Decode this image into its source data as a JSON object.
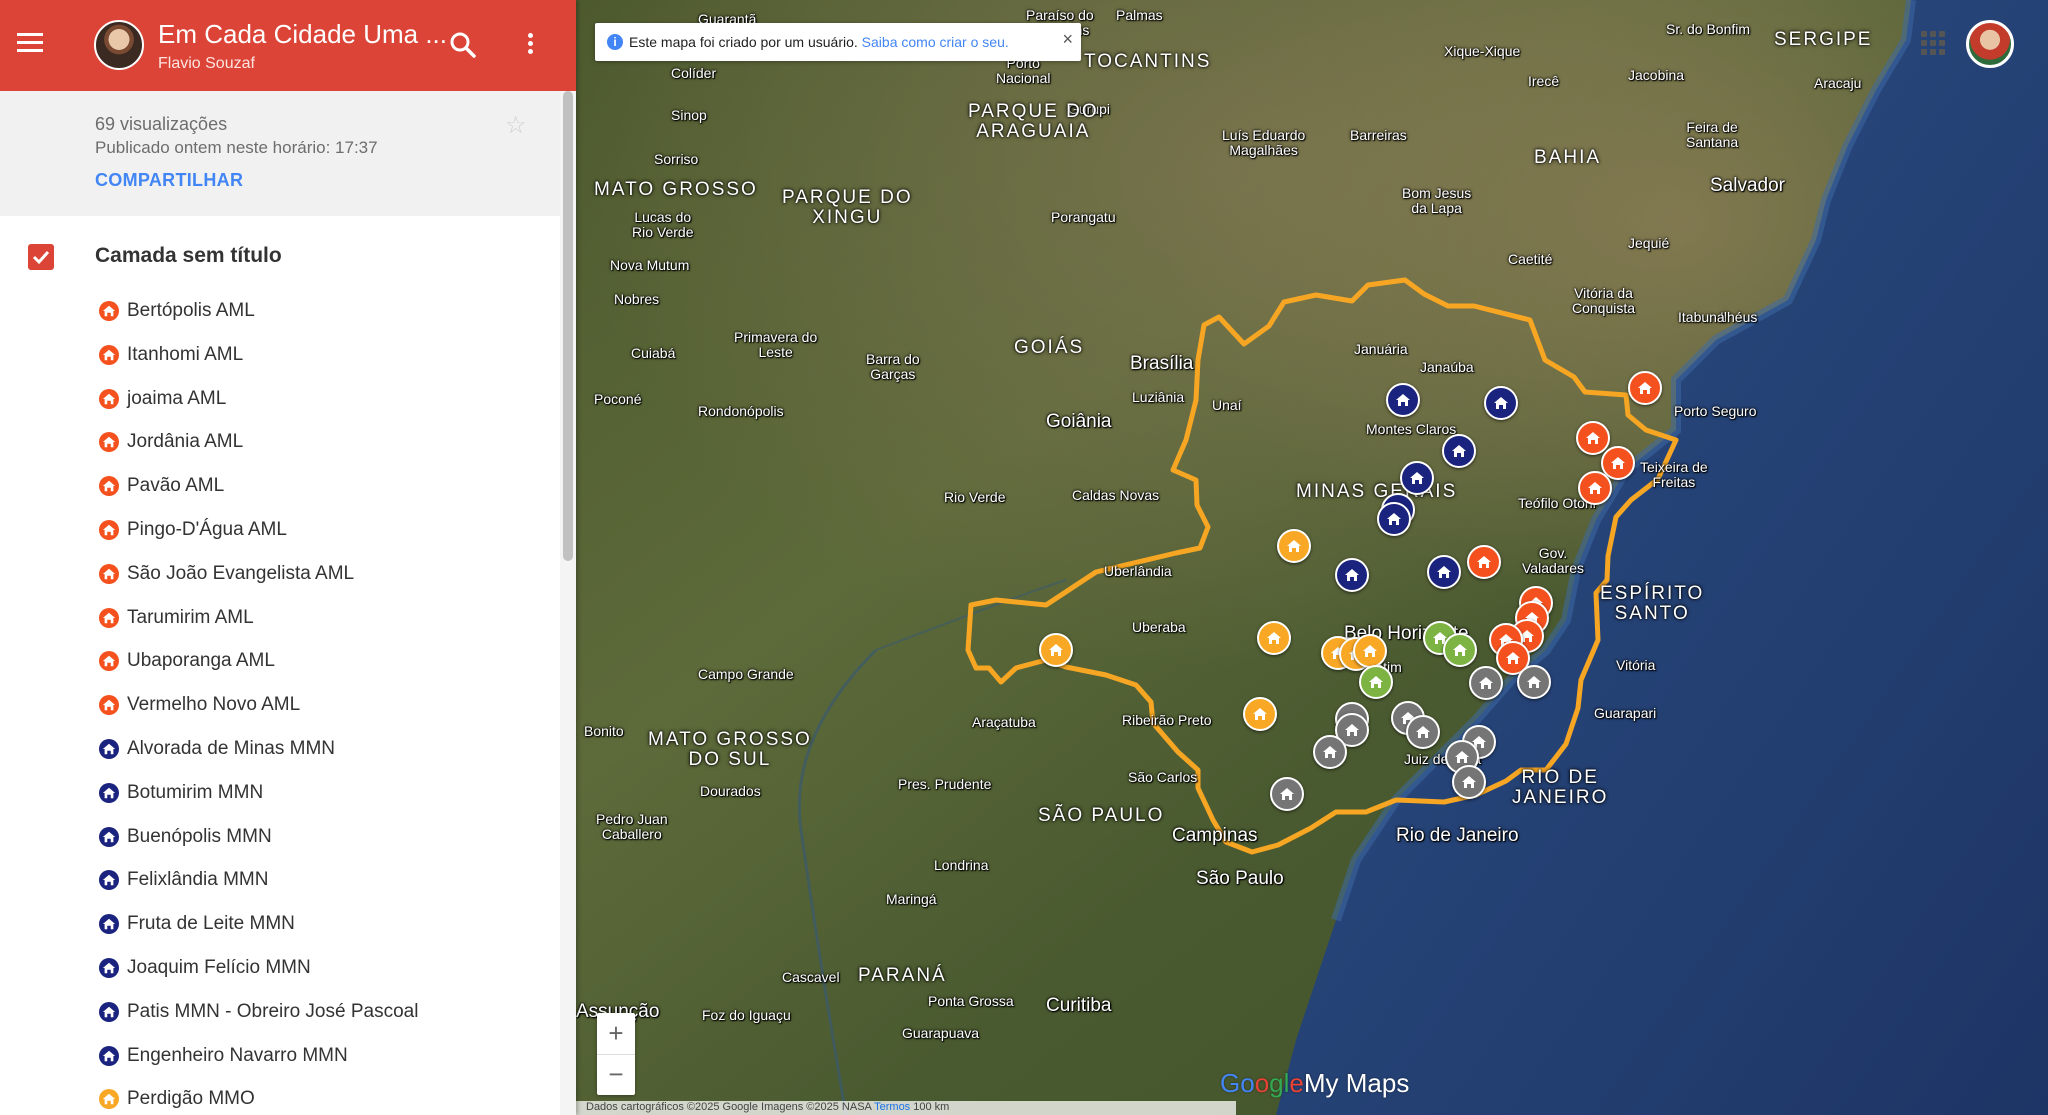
{
  "header": {
    "title": "Em Cada Cidade Uma ...",
    "author": "Flavio Souzaf"
  },
  "info": {
    "views": "69 visualizações",
    "published": "Publicado ontem neste horário: 17:37",
    "share": "COMPARTILHAR"
  },
  "layer": {
    "title": "Camada sem título",
    "checked": true
  },
  "colors": {
    "header": "#db4437",
    "orange": "#f4511e",
    "navy": "#1a237e",
    "yellow": "#f9a825",
    "green": "#7cb342",
    "gray": "#757575",
    "boundary": "#f6a623"
  },
  "items": [
    {
      "label": "Bertópolis AML",
      "color": "#f4511e"
    },
    {
      "label": "Itanhomi AML",
      "color": "#f4511e"
    },
    {
      "label": "joaima AML",
      "color": "#f4511e"
    },
    {
      "label": "Jordânia AML",
      "color": "#f4511e"
    },
    {
      "label": "Pavão AML",
      "color": "#f4511e"
    },
    {
      "label": "Pingo-D'Água AML",
      "color": "#f4511e"
    },
    {
      "label": "São João Evangelista AML",
      "color": "#f4511e"
    },
    {
      "label": "Tarumirim AML",
      "color": "#f4511e"
    },
    {
      "label": "Ubaporanga AML",
      "color": "#f4511e"
    },
    {
      "label": "Vermelho Novo AML",
      "color": "#f4511e"
    },
    {
      "label": "Alvorada de Minas MMN",
      "color": "#1a237e"
    },
    {
      "label": "Botumirim MMN",
      "color": "#1a237e"
    },
    {
      "label": "Buenópolis MMN",
      "color": "#1a237e"
    },
    {
      "label": "Felixlândia MMN",
      "color": "#1a237e"
    },
    {
      "label": "Fruta de Leite MMN",
      "color": "#1a237e"
    },
    {
      "label": "Joaquim Felício MMN",
      "color": "#1a237e"
    },
    {
      "label": "Patis MMN - Obreiro José Pascoal",
      "color": "#1a237e"
    },
    {
      "label": "Engenheiro Navarro MMN",
      "color": "#1a237e"
    },
    {
      "label": "Perdigão MMO",
      "color": "#f9a825"
    }
  ],
  "notice": {
    "text": "Este mapa foi criado por um usuário.",
    "link": "Saiba como criar o seu.",
    "close": "×"
  },
  "zoom": {
    "in": "+",
    "out": "−"
  },
  "logo": {
    "g": "Go",
    "o2": "o",
    "gl": "gl",
    "e": "e",
    "my_maps": "My Maps"
  },
  "attribution": {
    "text": "Dados cartográficos ©2025 Google Imagens ©2025 NASA",
    "terms": "Termos",
    "scale": "100 km"
  },
  "map_labels": {
    "cities": [
      {
        "name": "Guarantã"
      },
      {
        "name": "Paraíso do Tocantins"
      },
      {
        "name": "Palmas"
      },
      {
        "name": "Colíder"
      },
      {
        "name": "Porto Nacional"
      },
      {
        "name": "Sinop"
      },
      {
        "name": "Sorriso"
      },
      {
        "name": "Lucas do Rio Verde"
      },
      {
        "name": "Nova Mutum"
      },
      {
        "name": "Nobres"
      },
      {
        "name": "Cuiabá"
      },
      {
        "name": "Poconé"
      },
      {
        "name": "Primavera do Leste"
      },
      {
        "name": "Rondonópolis"
      },
      {
        "name": "Barra do Garças"
      },
      {
        "name": "Gurupi"
      },
      {
        "name": "Porangatu"
      },
      {
        "name": "Brasília"
      },
      {
        "name": "Luziânia"
      },
      {
        "name": "Goiânia"
      },
      {
        "name": "Unaí"
      },
      {
        "name": "Rio Verde"
      },
      {
        "name": "Caldas Novas"
      },
      {
        "name": "Uberlândia"
      },
      {
        "name": "Uberaba"
      },
      {
        "name": "Campo Grande"
      },
      {
        "name": "Araçatuba"
      },
      {
        "name": "Ribeirão Preto"
      },
      {
        "name": "São Carlos"
      },
      {
        "name": "Dourados"
      },
      {
        "name": "Pres. Prudente"
      },
      {
        "name": "Campinas"
      },
      {
        "name": "São Paulo"
      },
      {
        "name": "Londrina"
      },
      {
        "name": "Maringá"
      },
      {
        "name": "Cascavel"
      },
      {
        "name": "Ponta Grossa"
      },
      {
        "name": "Curitiba"
      },
      {
        "name": "Guarapuava"
      },
      {
        "name": "Foz do Iguaçu"
      },
      {
        "name": "Assunção"
      },
      {
        "name": "Pedro Juan Caballero"
      },
      {
        "name": "Bonito"
      },
      {
        "name": "Rio de Janeiro"
      },
      {
        "name": "Juiz de Fora"
      },
      {
        "name": "Belo Horizonte"
      },
      {
        "name": "Betim"
      },
      {
        "name": "Montes Claros"
      },
      {
        "name": "Januária"
      },
      {
        "name": "Janaúba"
      },
      {
        "name": "Teófilo Otoni"
      },
      {
        "name": "Gov. Valadares"
      },
      {
        "name": "Vitória"
      },
      {
        "name": "Guarapari"
      },
      {
        "name": "Porto Seguro"
      },
      {
        "name": "Teixeira de Freitas"
      },
      {
        "name": "Ilhéus"
      },
      {
        "name": "Itabuna"
      },
      {
        "name": "Vitória da Conquista"
      },
      {
        "name": "Jequié"
      },
      {
        "name": "Caetité"
      },
      {
        "name": "Bom Jesus da Lapa"
      },
      {
        "name": "Barreiras"
      },
      {
        "name": "Luís Eduardo Magalhães"
      },
      {
        "name": "Salvador"
      },
      {
        "name": "Feira de Santana"
      },
      {
        "name": "Aracaju"
      },
      {
        "name": "Sr. do Bonfim"
      },
      {
        "name": "Jacobina"
      },
      {
        "name": "Irecê"
      },
      {
        "name": "Xique-Xique"
      }
    ],
    "regions": [
      {
        "name": "TOCANTINS"
      },
      {
        "name": "MATO GROSSO"
      },
      {
        "name": "PARQUE DO XINGU"
      },
      {
        "name": "PARQUE DO ARAGUAIA"
      },
      {
        "name": "GOIÁS"
      },
      {
        "name": "MINAS GERAIS"
      },
      {
        "name": "BAHIA"
      },
      {
        "name": "SERGIPE"
      },
      {
        "name": "ESPÍRITO SANTO"
      },
      {
        "name": "MATO GROSSO DO SUL"
      },
      {
        "name": "SÃO PAULO"
      },
      {
        "name": "RIO DE JANEIRO"
      },
      {
        "name": "PARANÁ"
      }
    ]
  }
}
